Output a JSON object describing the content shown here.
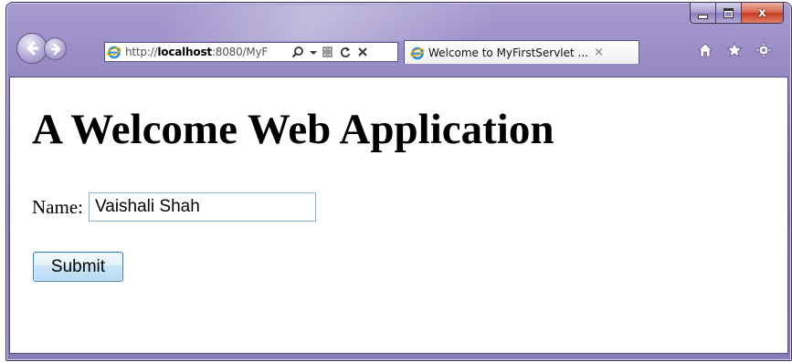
{
  "window": {
    "caption_buttons": {
      "minimize_icon": "minimize-icon",
      "maximize_icon": "maximize-icon",
      "close_icon": "close-icon",
      "close_glyph": "x"
    },
    "accent_color": "#8d7fbe",
    "close_color": "#c43d22"
  },
  "toolbar": {
    "back_icon": "back-arrow-icon",
    "forward_icon": "forward-arrow-icon",
    "address": {
      "scheme": "http://",
      "host": "localhost",
      "rest": ":8080/MyF",
      "tools": [
        "search-icon",
        "dropdown-icon",
        "compatibility-view-icon",
        "refresh-icon",
        "stop-icon"
      ]
    },
    "tab": {
      "label": "Welcome to MyFirstServlet ...",
      "close": "×"
    },
    "right_icons": [
      "home-icon",
      "favorites-star-icon",
      "tools-gear-icon"
    ]
  },
  "page": {
    "heading": "A Welcome Web Application",
    "name_label": "Name:",
    "name_value": "Vaishali Shah",
    "submit_label": "Submit"
  }
}
